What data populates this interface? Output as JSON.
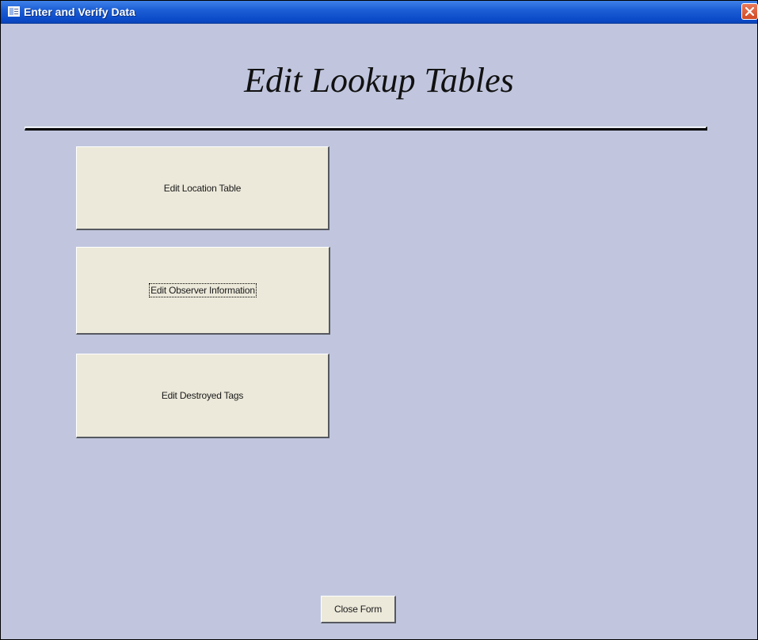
{
  "window": {
    "title": "Enter and Verify Data",
    "icon": "form-window-icon",
    "close_icon": "close-x-icon"
  },
  "form": {
    "heading": "Edit Lookup Tables"
  },
  "buttons": {
    "edit_location": "Edit Location Table",
    "edit_observer": "Edit Observer Information",
    "edit_destroyed": "Edit Destroyed Tags",
    "close_form": "Close Form"
  },
  "colors": {
    "form_background": "#c1c6de",
    "button_face": "#ece9da",
    "titlebar_blue": "#0b4ac8",
    "close_red": "#d14a25"
  }
}
